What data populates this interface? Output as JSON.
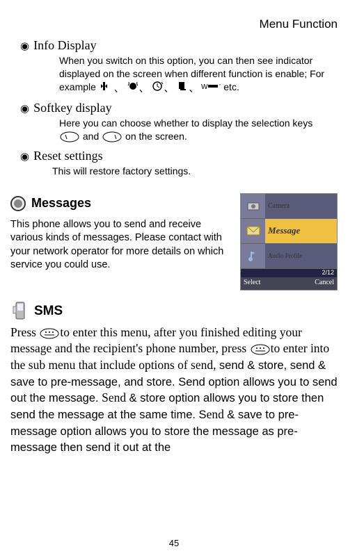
{
  "header": "Menu Function",
  "sections": [
    {
      "title": "Info Display",
      "body_pre": "When you switch on this option, you can then see indicator displayed on the screen when different function is enable; For example ",
      "body_post": " etc."
    },
    {
      "title": "Softkey display",
      "body_pre": "Here you can choose whether to display the selection keys ",
      "body_mid": " and  ",
      "body_post": " on the screen."
    },
    {
      "title": "Reset settings",
      "body": "This will restore factory settings."
    }
  ],
  "messages": {
    "title": "Messages",
    "desc": "This phone allows you to send and receive various kinds of messages. Please contact with your network operator for more details on which service you could use."
  },
  "phone": {
    "rows": [
      {
        "label": "Camera"
      },
      {
        "label": "Message",
        "sel": true
      },
      {
        "label": "Audio Profile"
      }
    ],
    "counter": "2/12",
    "left": "Select",
    "right": "Cancel"
  },
  "sms": {
    "title": "SMS",
    "p1a": "Press  ",
    "p1b": "to enter this menu, after you finished editing your message and the recipient's phone number, press ",
    "p2_serif": "to enter into the sub menu that include options of send, ",
    "p2_sans": "send & store, send & save to pre-message, and store. Send option allows you to send out the message. ",
    "p3_serif": "Send ",
    "p3_sans": "& store option allows you to store then send the message at the same time. S",
    "p4_serif": "end ",
    "p4_sans": "& save to pre-message option allows you to store the message as pre-message then send it out at the"
  },
  "page": "45"
}
